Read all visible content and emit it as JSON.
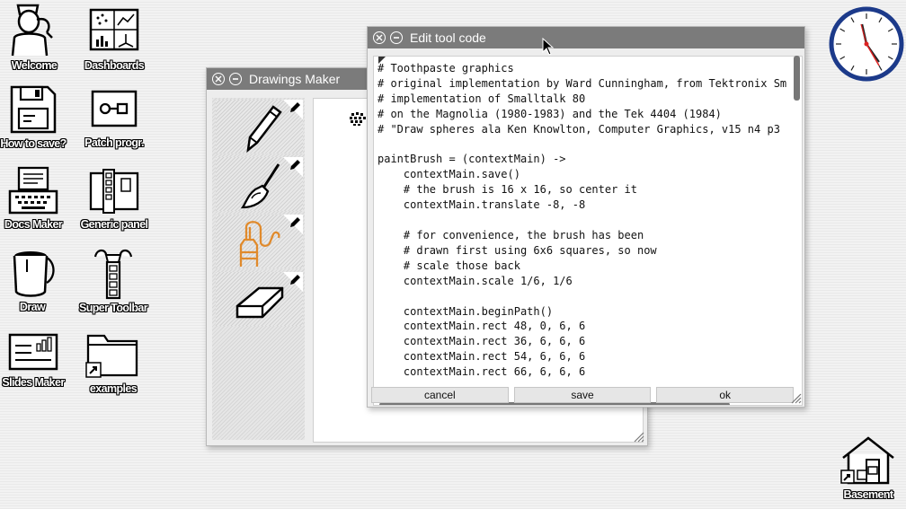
{
  "desktop": {
    "icons": [
      {
        "id": "welcome",
        "label": "Welcome",
        "icon": "person-icon"
      },
      {
        "id": "dashboards",
        "label": "Dashboards",
        "icon": "dashboard-icon"
      },
      {
        "id": "howtosave",
        "label": "How to save?",
        "icon": "floppy-disk-icon"
      },
      {
        "id": "patch",
        "label": "Patch progr.",
        "icon": "patch-icon"
      },
      {
        "id": "docsmaker",
        "label": "Docs Maker",
        "icon": "typewriter-icon"
      },
      {
        "id": "generic",
        "label": "Generic panel",
        "icon": "panel-icon"
      },
      {
        "id": "draw",
        "label": "Draw",
        "icon": "paint-bucket-icon"
      },
      {
        "id": "supertoolbar",
        "label": "Super Toolbar",
        "icon": "toolbar-icon"
      },
      {
        "id": "slides",
        "label": "Slides Maker",
        "icon": "slides-icon"
      },
      {
        "id": "examples",
        "label": "examples",
        "icon": "folder-icon"
      },
      {
        "id": "basement",
        "label": "Basement",
        "icon": "house-icon"
      }
    ]
  },
  "drawings_window": {
    "title": "Drawings Maker",
    "tools": [
      "pencil",
      "brush",
      "toothpaste",
      "eraser"
    ]
  },
  "code_window": {
    "title": "Edit tool code",
    "code": "# Toothpaste graphics\n# original implementation by Ward Cunningham, from Tektronix Sm\n# implementation of Smalltalk 80\n# on the Magnolia (1980-1983) and the Tek 4404 (1984)\n# \"Draw spheres ala Ken Knowlton, Computer Graphics, v15 n4 p3\n\npaintBrush = (contextMain) ->\n    contextMain.save()\n    # the brush is 16 x 16, so center it\n    contextMain.translate -8, -8\n\n    # for convenience, the brush has been\n    # drawn first using 6x6 squares, so now\n    # scale those back\n    contextMain.scale 1/6, 1/6\n\n    contextMain.beginPath()\n    contextMain.rect 48, 0, 6, 6\n    contextMain.rect 36, 6, 6, 6\n    contextMain.rect 54, 6, 6, 6\n    contextMain.rect 66, 6, 6, 6",
    "buttons": {
      "cancel": "cancel",
      "save": "save",
      "ok": "ok"
    }
  },
  "colors": {
    "titlebar": "#7b7b7b",
    "accent_orange": "#e08a2c"
  }
}
